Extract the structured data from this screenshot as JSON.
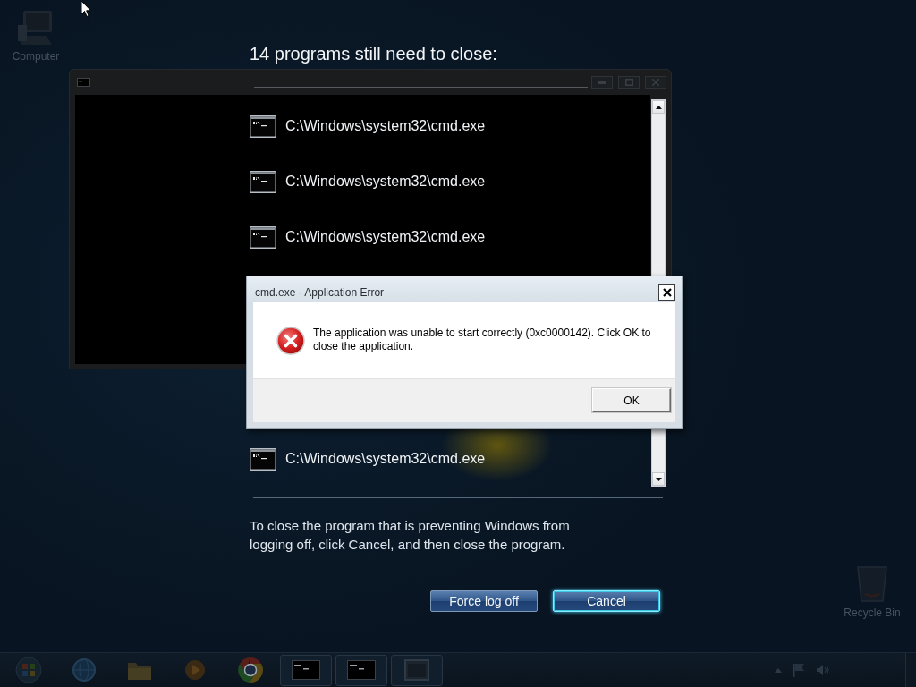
{
  "desktop_icons": [
    {
      "kind": "computer",
      "label": "Computer"
    },
    {
      "kind": "recycle-bin",
      "label": "Recycle Bin"
    }
  ],
  "logoff_screen": {
    "heading": "14 programs still need to close:",
    "programs": [
      {
        "name": "C:\\Windows\\system32\\cmd.exe"
      },
      {
        "name": "C:\\Windows\\system32\\cmd.exe"
      },
      {
        "name": "C:\\Windows\\system32\\cmd.exe"
      },
      {
        "name": "C:\\Windows\\system32\\cmd.exe"
      }
    ],
    "message": "To close the program that is preventing Windows from logging off, click Cancel, and then close the program.",
    "buttons": [
      {
        "label": "Force log off",
        "focused": false
      },
      {
        "label": "Cancel",
        "focused": true
      }
    ]
  },
  "error_dialog": {
    "title": "cmd.exe - Application Error",
    "message": "The application was unable to start correctly (0xc0000142). Click OK to close the application.",
    "button": "OK"
  },
  "taskbar": {
    "items": [
      {
        "kind": "start",
        "running": false
      },
      {
        "kind": "browser",
        "running": false
      },
      {
        "kind": "folder",
        "running": false
      },
      {
        "kind": "media",
        "running": false
      },
      {
        "kind": "chrome",
        "running": false
      },
      {
        "kind": "console",
        "running": true
      },
      {
        "kind": "console",
        "running": true
      },
      {
        "kind": "window",
        "running": true
      }
    ]
  }
}
